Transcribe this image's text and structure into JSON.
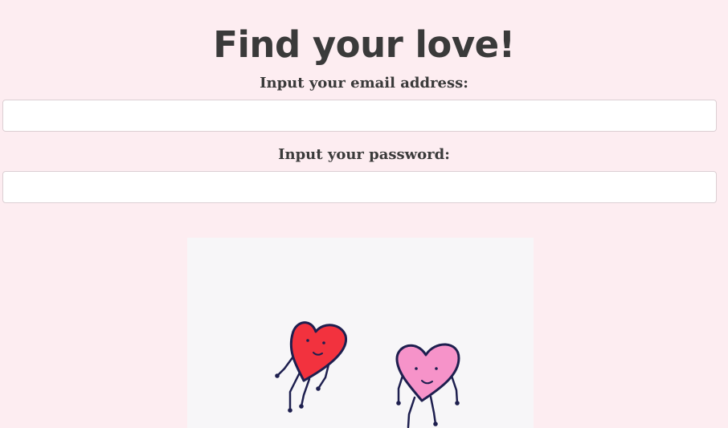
{
  "heading": "Find your love!",
  "form": {
    "email": {
      "label": "Input your email address:",
      "value": "",
      "placeholder": ""
    },
    "password": {
      "label": "Input your password:",
      "value": "",
      "placeholder": ""
    }
  },
  "illustration": {
    "subject": "two-dancing-hearts",
    "colors": {
      "left_heart": "#f2323e",
      "right_heart": "#f693c9",
      "outline": "#1e1f4f",
      "background": "#f7f6f8"
    }
  },
  "colors": {
    "page_background": "#fdedf1",
    "text": "#3a3a3a"
  }
}
